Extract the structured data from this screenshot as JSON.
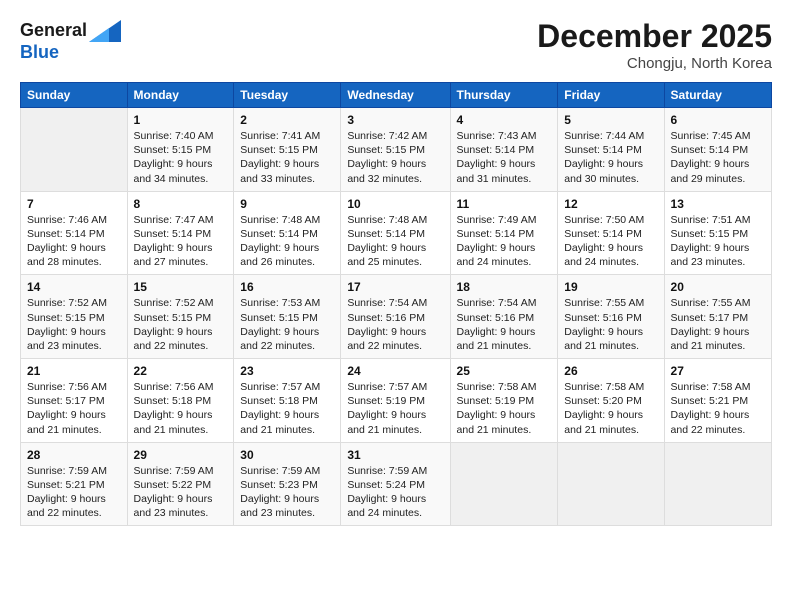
{
  "header": {
    "logo_line1": "General",
    "logo_line2": "Blue",
    "month": "December 2025",
    "location": "Chongju, North Korea"
  },
  "days_of_week": [
    "Sunday",
    "Monday",
    "Tuesday",
    "Wednesday",
    "Thursday",
    "Friday",
    "Saturday"
  ],
  "weeks": [
    [
      {
        "day": "",
        "sunrise": "",
        "sunset": "",
        "daylight": ""
      },
      {
        "day": "1",
        "sunrise": "7:40 AM",
        "sunset": "5:15 PM",
        "daylight": "9 hours and 34 minutes."
      },
      {
        "day": "2",
        "sunrise": "7:41 AM",
        "sunset": "5:15 PM",
        "daylight": "9 hours and 33 minutes."
      },
      {
        "day": "3",
        "sunrise": "7:42 AM",
        "sunset": "5:15 PM",
        "daylight": "9 hours and 32 minutes."
      },
      {
        "day": "4",
        "sunrise": "7:43 AM",
        "sunset": "5:14 PM",
        "daylight": "9 hours and 31 minutes."
      },
      {
        "day": "5",
        "sunrise": "7:44 AM",
        "sunset": "5:14 PM",
        "daylight": "9 hours and 30 minutes."
      },
      {
        "day": "6",
        "sunrise": "7:45 AM",
        "sunset": "5:14 PM",
        "daylight": "9 hours and 29 minutes."
      }
    ],
    [
      {
        "day": "7",
        "sunrise": "7:46 AM",
        "sunset": "5:14 PM",
        "daylight": "9 hours and 28 minutes."
      },
      {
        "day": "8",
        "sunrise": "7:47 AM",
        "sunset": "5:14 PM",
        "daylight": "9 hours and 27 minutes."
      },
      {
        "day": "9",
        "sunrise": "7:48 AM",
        "sunset": "5:14 PM",
        "daylight": "9 hours and 26 minutes."
      },
      {
        "day": "10",
        "sunrise": "7:48 AM",
        "sunset": "5:14 PM",
        "daylight": "9 hours and 25 minutes."
      },
      {
        "day": "11",
        "sunrise": "7:49 AM",
        "sunset": "5:14 PM",
        "daylight": "9 hours and 24 minutes."
      },
      {
        "day": "12",
        "sunrise": "7:50 AM",
        "sunset": "5:14 PM",
        "daylight": "9 hours and 24 minutes."
      },
      {
        "day": "13",
        "sunrise": "7:51 AM",
        "sunset": "5:15 PM",
        "daylight": "9 hours and 23 minutes."
      }
    ],
    [
      {
        "day": "14",
        "sunrise": "7:52 AM",
        "sunset": "5:15 PM",
        "daylight": "9 hours and 23 minutes."
      },
      {
        "day": "15",
        "sunrise": "7:52 AM",
        "sunset": "5:15 PM",
        "daylight": "9 hours and 22 minutes."
      },
      {
        "day": "16",
        "sunrise": "7:53 AM",
        "sunset": "5:15 PM",
        "daylight": "9 hours and 22 minutes."
      },
      {
        "day": "17",
        "sunrise": "7:54 AM",
        "sunset": "5:16 PM",
        "daylight": "9 hours and 22 minutes."
      },
      {
        "day": "18",
        "sunrise": "7:54 AM",
        "sunset": "5:16 PM",
        "daylight": "9 hours and 21 minutes."
      },
      {
        "day": "19",
        "sunrise": "7:55 AM",
        "sunset": "5:16 PM",
        "daylight": "9 hours and 21 minutes."
      },
      {
        "day": "20",
        "sunrise": "7:55 AM",
        "sunset": "5:17 PM",
        "daylight": "9 hours and 21 minutes."
      }
    ],
    [
      {
        "day": "21",
        "sunrise": "7:56 AM",
        "sunset": "5:17 PM",
        "daylight": "9 hours and 21 minutes."
      },
      {
        "day": "22",
        "sunrise": "7:56 AM",
        "sunset": "5:18 PM",
        "daylight": "9 hours and 21 minutes."
      },
      {
        "day": "23",
        "sunrise": "7:57 AM",
        "sunset": "5:18 PM",
        "daylight": "9 hours and 21 minutes."
      },
      {
        "day": "24",
        "sunrise": "7:57 AM",
        "sunset": "5:19 PM",
        "daylight": "9 hours and 21 minutes."
      },
      {
        "day": "25",
        "sunrise": "7:58 AM",
        "sunset": "5:19 PM",
        "daylight": "9 hours and 21 minutes."
      },
      {
        "day": "26",
        "sunrise": "7:58 AM",
        "sunset": "5:20 PM",
        "daylight": "9 hours and 21 minutes."
      },
      {
        "day": "27",
        "sunrise": "7:58 AM",
        "sunset": "5:21 PM",
        "daylight": "9 hours and 22 minutes."
      }
    ],
    [
      {
        "day": "28",
        "sunrise": "7:59 AM",
        "sunset": "5:21 PM",
        "daylight": "9 hours and 22 minutes."
      },
      {
        "day": "29",
        "sunrise": "7:59 AM",
        "sunset": "5:22 PM",
        "daylight": "9 hours and 23 minutes."
      },
      {
        "day": "30",
        "sunrise": "7:59 AM",
        "sunset": "5:23 PM",
        "daylight": "9 hours and 23 minutes."
      },
      {
        "day": "31",
        "sunrise": "7:59 AM",
        "sunset": "5:24 PM",
        "daylight": "9 hours and 24 minutes."
      },
      {
        "day": "",
        "sunrise": "",
        "sunset": "",
        "daylight": ""
      },
      {
        "day": "",
        "sunrise": "",
        "sunset": "",
        "daylight": ""
      },
      {
        "day": "",
        "sunrise": "",
        "sunset": "",
        "daylight": ""
      }
    ]
  ]
}
